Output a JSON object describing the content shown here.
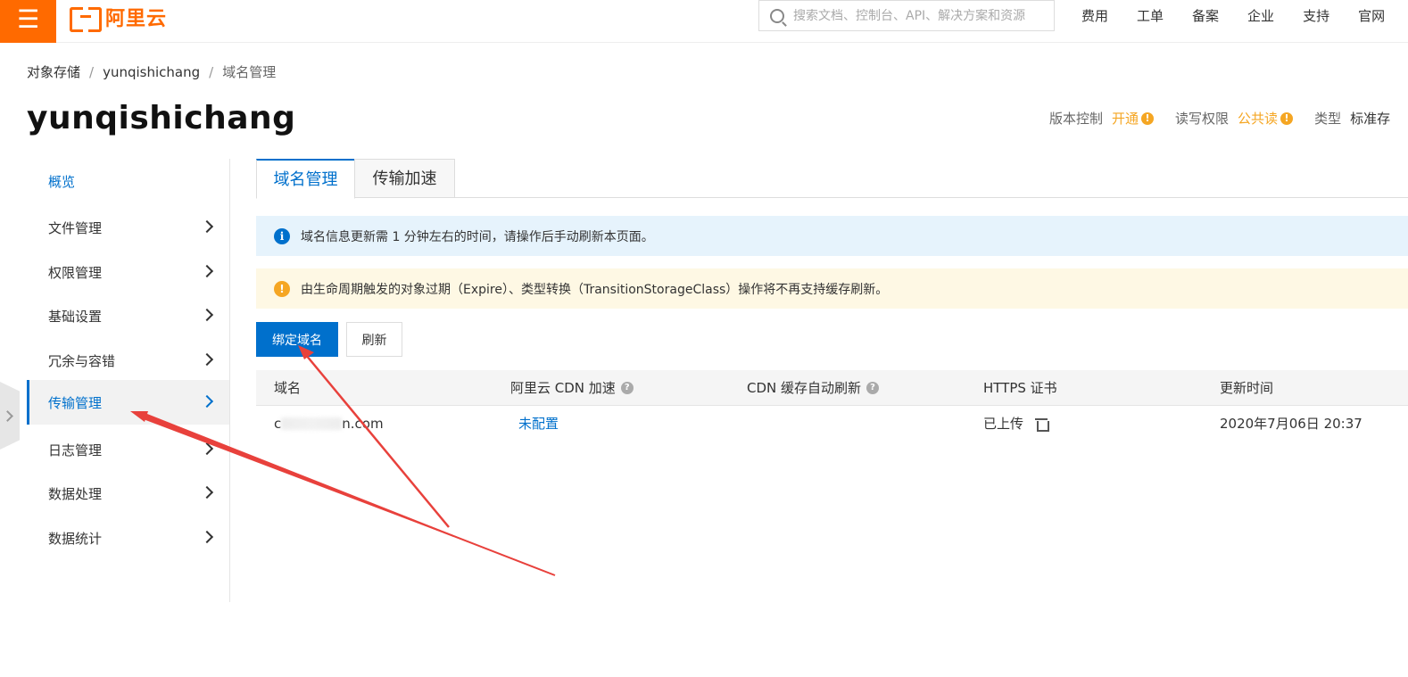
{
  "topbar": {
    "menu_icon": "menu-icon",
    "logo_text": "阿里云",
    "search_placeholder": "搜索文档、控制台、API、解决方案和资源",
    "nav": [
      "费用",
      "工单",
      "备案",
      "企业",
      "支持",
      "官网"
    ]
  },
  "breadcrumb": [
    "对象存储",
    "yunqishichang",
    "域名管理"
  ],
  "page_title": "yunqishichang",
  "meta": {
    "version_label": "版本控制",
    "version_value": "开通",
    "acl_label": "读写权限",
    "acl_value": "公共读",
    "type_label": "类型",
    "type_value": "标准存"
  },
  "sidebar": {
    "items": [
      {
        "label": "概览"
      },
      {
        "label": "文件管理"
      },
      {
        "label": "权限管理"
      },
      {
        "label": "基础设置"
      },
      {
        "label": "冗余与容错"
      },
      {
        "label": "传输管理"
      },
      {
        "label": "日志管理"
      },
      {
        "label": "数据处理"
      },
      {
        "label": "数据统计"
      }
    ],
    "selected": "传输管理"
  },
  "tabs": [
    {
      "label": "域名管理",
      "active": true
    },
    {
      "label": "传输加速",
      "active": false
    }
  ],
  "alerts": {
    "info": "域名信息更新需 1 分钟左右的时间，请操作后手动刷新本页面。",
    "warn": "由生命周期触发的对象过期（Expire）、类型转换（TransitionStorageClass）操作将不再支持缓存刷新。"
  },
  "buttons": {
    "bind_domain": "绑定域名",
    "refresh": "刷新"
  },
  "table": {
    "headers": [
      "域名",
      "阿里云 CDN 加速",
      "CDN 缓存自动刷新",
      "HTTPS 证书",
      "更新时间"
    ],
    "rows": [
      {
        "domain_prefix": "c",
        "domain_suffix": "n.com",
        "cdn": "未配置",
        "cdn_refresh": "",
        "https": "已上传",
        "updated": "2020年7月06日 20:37"
      }
    ]
  },
  "colors": {
    "brand": "#ff6a00",
    "primary": "#0070cc",
    "warning": "#f5a623",
    "annotation": "#e8413c"
  }
}
